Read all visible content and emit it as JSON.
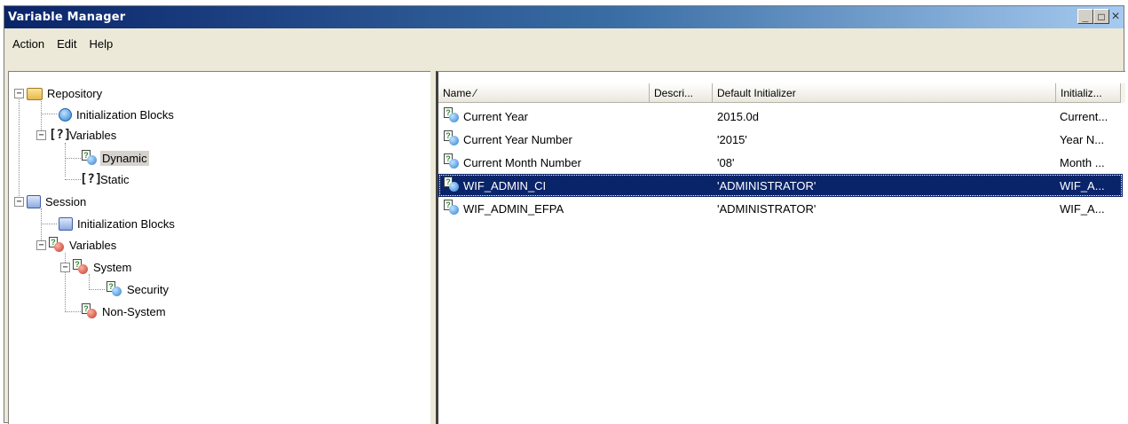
{
  "window": {
    "title": "Variable Manager",
    "controls": {
      "minimize": "_",
      "maximize": "□",
      "close": "×"
    }
  },
  "menu": {
    "items": [
      "Action",
      "Edit",
      "Help"
    ]
  },
  "tree": {
    "repository": "Repository",
    "repo_init_blocks": "Initialization Blocks",
    "repo_variables": "Variables",
    "dynamic": "Dynamic",
    "static": "Static",
    "session": "Session",
    "session_init_blocks": "Initialization Blocks",
    "session_variables": "Variables",
    "system": "System",
    "security": "Security",
    "non_system": "Non-System",
    "expander_minus": "−",
    "var_glyph": "[?]"
  },
  "list": {
    "columns": [
      "Name ⁄",
      "Descri...",
      "Default Initializer",
      "Initializ..."
    ],
    "rows": [
      {
        "name": "Current Year",
        "description": "",
        "default_initializer": "2015.0d",
        "initializer": "Current..."
      },
      {
        "name": "Current Year Number",
        "description": "",
        "default_initializer": "'2015'",
        "initializer": "Year N..."
      },
      {
        "name": "Current Month Number",
        "description": "",
        "default_initializer": "'08'",
        "initializer": "Month ..."
      },
      {
        "name": "WIF_ADMIN_CI",
        "description": "",
        "default_initializer": "'ADMINISTRATOR'",
        "initializer": "WIF_A..."
      },
      {
        "name": "WIF_ADMIN_EFPA",
        "description": "",
        "default_initializer": "'ADMINISTRATOR'",
        "initializer": "WIF_A..."
      }
    ]
  },
  "colors": {
    "selection": "#0a246a",
    "title_gradient_start": "#0a246a",
    "title_gradient_end": "#a6caf0"
  }
}
